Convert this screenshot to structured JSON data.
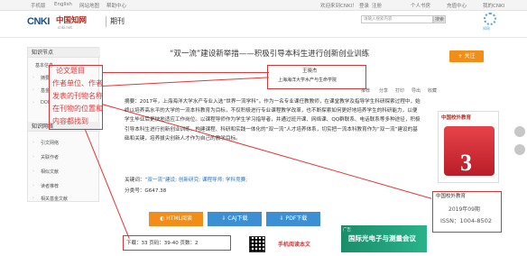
{
  "topbar": {
    "links": [
      "手机版",
      "English",
      "网站地图",
      "帮助中心"
    ],
    "right_links": [
      "欢迎来到CNKI！",
      "登录",
      "注册",
      "个人书房",
      "充值中心",
      "我的CNKI"
    ]
  },
  "header": {
    "logo_cnki": "CNKI",
    "logo_cn": "中国知网",
    "logo_url": "cnki.net",
    "section": "期刊",
    "search_placeholder": "请输入搜索内容",
    "search_button": "搜索",
    "right_logo_text": "知网"
  },
  "sidebar": {
    "knowledge_title": "知识节点",
    "basic_info": "基本信息",
    "items1": [
      "摘要",
      "基金",
      "DOI"
    ],
    "knowledge_link_title": "知识网络",
    "items2": [
      "引文网络",
      "关联作者",
      "相似文献",
      "读者推荐",
      "相关基金文献"
    ]
  },
  "annotation": {
    "lines": [
      "论文题目",
      "作者单位、作者",
      "发表的刊物名称",
      "在刊物的位置和",
      "内容都找到"
    ]
  },
  "article": {
    "title": "“双一流”建设新举措——积极引导本科生进行创新创业训练",
    "author": "王晓杰",
    "affiliation": "上海海洋大学水产与生命学院",
    "toolbar": [
      "推荐",
      "分享",
      "打印",
      "导出",
      "收藏"
    ],
    "abstract": "摘要：2017年，上海海洋大学水产专业入选“世界一流学科”。作为一名专业课任教教师，在课堂教学及指导学生科研探索过程中，始终以培养高水平的大学的一流本科教育为目标，不仅积极进行专业课程教学改革，也不断探索如何更好地培养学生的科研能力，以便学生毕业后更快地适应工作岗位。以课程导师作为学生学习指导者，并通过班开课、网络课、QQ群联系、电话联系等多种途径，积极引导本科生进行创新创业训练，构建课程、科研和实践一体化的“双一流”人才培养体系，切实把一流本科教育作为“双一流”建设的基础和关键，培养拔尖创新人才作为自己的教学目标。",
    "keywords_label": "关键词：",
    "keywords": "“双一流”建设; 创新研究; 课程导师; 学科竞赛;",
    "class_label": "分类号：",
    "class": "G647.38"
  },
  "journal": {
    "cover_title": "中国校外教育",
    "cover_number": "3",
    "name": "中国校外教育",
    "date": "2019年09期",
    "issn": "ISSN：1004-8502"
  },
  "buttons": {
    "html": "HTML阅读",
    "caj": "CAJ下载",
    "pdf": "PDF下载"
  },
  "stats": {
    "text": "下载：33  页码：39-40  页数：2"
  },
  "mobile": {
    "label": "手机阅读本文"
  },
  "ad": {
    "tag": "广告",
    "text": "国际光电子与测量会议"
  },
  "colors": {
    "annotation": "#e33333",
    "subscribe": "#f18e1a",
    "html_btn": "#f18e1a",
    "caj_btn": "#3d8fd4",
    "pdf_btn": "#3d8fd4"
  }
}
